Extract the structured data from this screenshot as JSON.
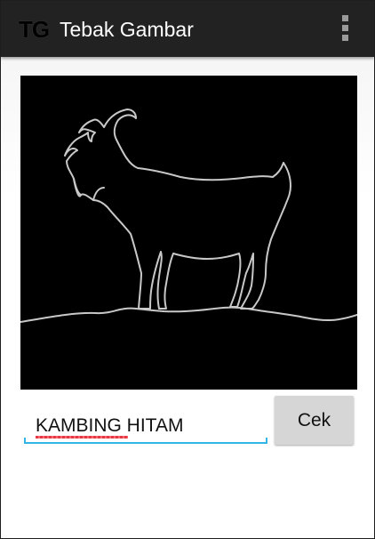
{
  "action_bar": {
    "app_icon_text": "TG",
    "title": "Tebak Gambar",
    "overflow_icon": "overflow-menu-icon"
  },
  "puzzle": {
    "image_subject": "goat",
    "background_color": "#000000",
    "outline_color": "#c8c8c8"
  },
  "answer": {
    "value": "KAMBING HITAM",
    "underline_color": "#33b5e5"
  },
  "check_button": {
    "label": "Cek"
  }
}
